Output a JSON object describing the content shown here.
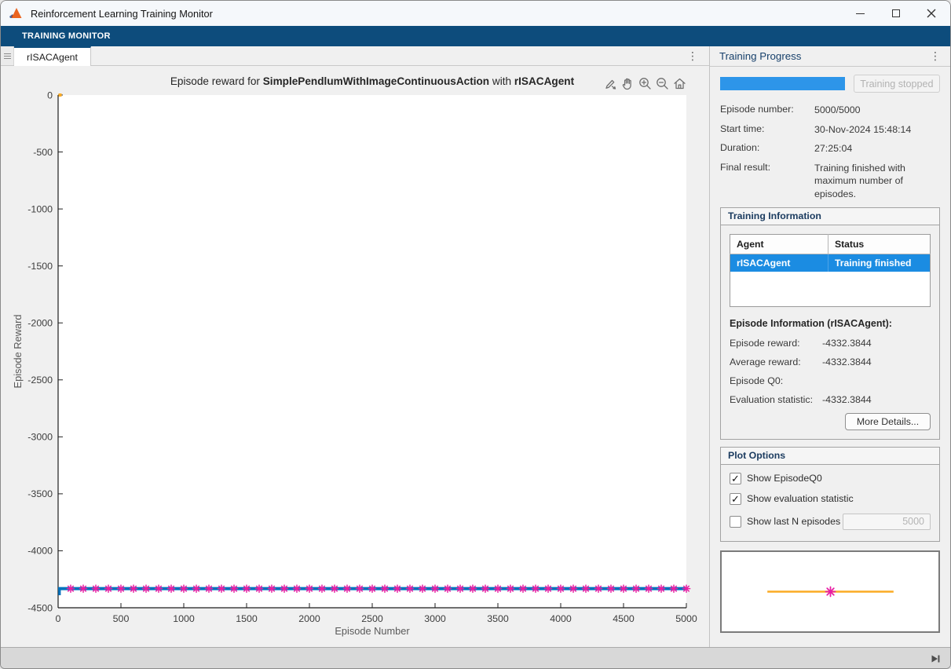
{
  "window": {
    "title": "Reinforcement Learning Training Monitor"
  },
  "ribbon": {
    "label": "TRAINING MONITOR"
  },
  "tab_strip": {
    "active_tab": "rISACAgent"
  },
  "icons": {
    "kebab": "⋮",
    "check": "✓"
  },
  "chart_data": {
    "type": "line",
    "title": {
      "prefix": "Episode reward for ",
      "environment": "SimplePendlumWithImageContinuousAction",
      "connector": " with ",
      "agent": "rISACAgent"
    },
    "xlabel": "Episode Number",
    "ylabel": "Episode Reward",
    "xlim": [
      0,
      5000
    ],
    "ylim": [
      -4500,
      0
    ],
    "xticks": [
      0,
      500,
      1000,
      1500,
      2000,
      2500,
      3000,
      3500,
      4000,
      4500,
      5000
    ],
    "yticks": [
      0,
      -500,
      -1000,
      -1500,
      -2000,
      -2500,
      -3000,
      -3500,
      -4000,
      -4500
    ],
    "grid": false,
    "series": [
      {
        "name": "Episode reward",
        "type": "line",
        "color": "#0072BD",
        "constant_value": -4332.3844,
        "x_start": 0,
        "x_end": 5000,
        "first_episode_value": -4390
      },
      {
        "name": "Average reward",
        "type": "line",
        "color": "#0072BD",
        "constant_value": -4332.3844,
        "x_start": 0,
        "x_end": 5000
      },
      {
        "name": "Evaluation statistic",
        "type": "asterisk-markers",
        "color": "#E81FA4",
        "marker_value": -4332.3844,
        "marker_start": 100,
        "marker_interval": 100,
        "marker_end": 5000
      },
      {
        "name": "EpisodeQ0",
        "type": "point",
        "color": "#FBAB24",
        "points": [
          [
            0,
            0
          ]
        ]
      }
    ],
    "toolbar": [
      "brush",
      "pan",
      "zoom-in",
      "zoom-out",
      "restore-view"
    ]
  },
  "progress_panel": {
    "title": "Training Progress",
    "progress_percent": 100,
    "stop_button": "Training stopped",
    "rows": [
      {
        "label": "Episode number:",
        "value": "5000/5000"
      },
      {
        "label": "Start time:",
        "value": "30-Nov-2024 15:48:14"
      },
      {
        "label": "Duration:",
        "value": "27:25:04"
      },
      {
        "label": "Final result:",
        "value": "Training finished with maximum number of episodes."
      }
    ]
  },
  "training_information": {
    "title": "Training Information",
    "table": {
      "columns": [
        "Agent",
        "Status"
      ],
      "rows": [
        {
          "agent": "rISACAgent",
          "status": "Training finished",
          "selected": true
        }
      ]
    },
    "episode_info": {
      "title": "Episode Information (rISACAgent):",
      "rows": [
        {
          "label": "Episode reward:",
          "value": "-4332.3844"
        },
        {
          "label": "Average reward:",
          "value": "-4332.3844"
        },
        {
          "label": "Episode Q0:",
          "value": ""
        },
        {
          "label": "Evaluation statistic:",
          "value": "-4332.3844"
        }
      ],
      "more_details_button": "More Details..."
    }
  },
  "plot_options": {
    "title": "Plot Options",
    "checkboxes": [
      {
        "label": "Show EpisodeQ0",
        "checked": true
      },
      {
        "label": "Show evaluation statistic",
        "checked": true
      },
      {
        "label": "Show last N episodes",
        "checked": false
      }
    ],
    "last_n_value": "5000"
  },
  "preview": {
    "line_color": "#FBAB24",
    "marker_color": "#E81FA4",
    "line_span": [
      0.21,
      0.79
    ],
    "line_y": 0.5
  },
  "colors": {
    "ribbon_navy": "#0D4C7C",
    "progress_blue": "#2D95E9",
    "selection_blue": "#1B8CE2",
    "line_blue": "#0072BD"
  }
}
